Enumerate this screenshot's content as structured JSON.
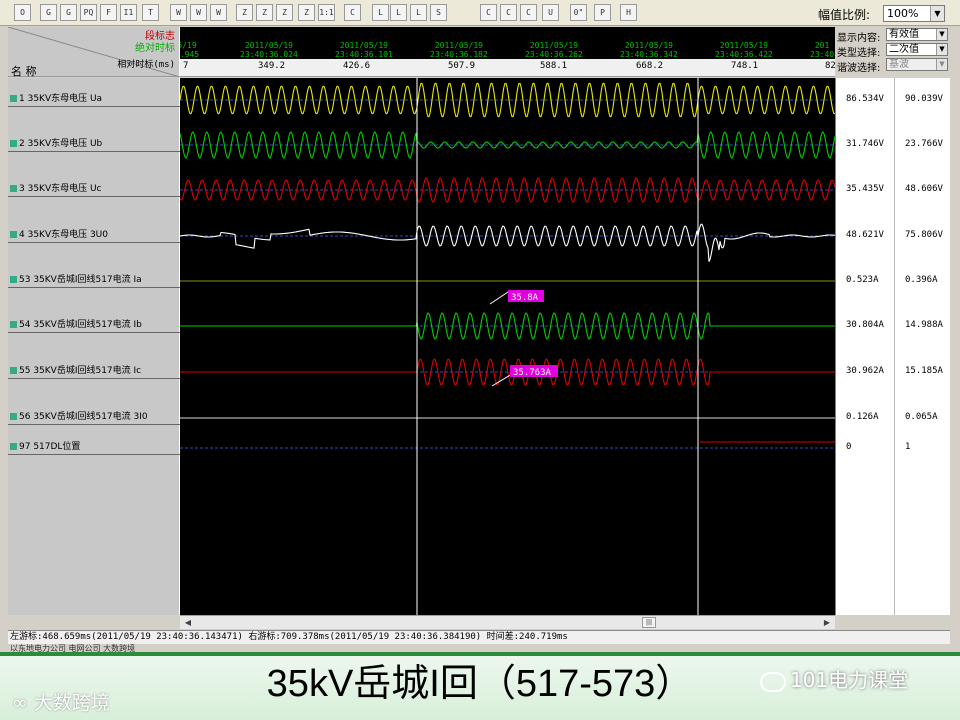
{
  "toolbar": {
    "buttons": [
      "open",
      "grid",
      "grid2",
      "PQ",
      "F",
      "I1",
      "table",
      "wave-a",
      "wave-b",
      "wave-c",
      "zoom-v-in",
      "zoom-v-out",
      "zoom-h-in",
      "zoom-h-out",
      "1:1",
      "check",
      "list-a",
      "list-b",
      "list-c",
      "settings",
      "cursor-a",
      "cursor-b",
      "cursor-c",
      "undo",
      "0\"",
      "print",
      "help"
    ],
    "scale_label": "幅值比例:",
    "scale_value": "100%"
  },
  "header": {
    "mark_label": "段标志",
    "abs_time_label": "绝对时标",
    "rel_time_label": "相对时标(ms)",
    "name_label": "名 称"
  },
  "timeline": {
    "dates": [
      {
        "d": "5/19",
        "t": "0.945"
      },
      {
        "d": "2011/05/19",
        "t": "23:40:36.024"
      },
      {
        "d": "2011/05/19",
        "t": "23:40:36.101"
      },
      {
        "d": "2011/05/19",
        "t": "23:40:36.182"
      },
      {
        "d": "2011/05/19",
        "t": "23:40:36.262"
      },
      {
        "d": "2011/05/19",
        "t": "23:40:36.342"
      },
      {
        "d": "2011/05/19",
        "t": "23:40:36.422"
      },
      {
        "d": "201",
        "t": "23:40"
      }
    ],
    "ms": [
      "7",
      "349.2",
      "426.6",
      "507.9",
      "588.1",
      "668.2",
      "748.1",
      "82"
    ]
  },
  "controls": {
    "display_label": "显示内容:",
    "display_value": "有效值",
    "type_label": "类型选择:",
    "type_value": "二次值",
    "harmonic_label": "谐波选择:",
    "harmonic_value": "基波"
  },
  "channels": [
    {
      "label": "1 35KV东母电压 Ua",
      "v1": "86.534V",
      "v2": "90.039V",
      "color": "#e8e800"
    },
    {
      "label": "2 35KV东母电压 Ub",
      "v1": "31.746V",
      "v2": "23.766V",
      "color": "#00d000"
    },
    {
      "label": "3 35KV东母电压 Uc",
      "v1": "35.435V",
      "v2": "48.606V",
      "color": "#e00000"
    },
    {
      "label": "4 35KV东母电压 3U0",
      "v1": "48.621V",
      "v2": "75.806V",
      "color": "#ffffff"
    },
    {
      "label": "53 35KV岳城Ⅰ回线517电流 Ia",
      "v1": "0.523A",
      "v2": "0.396A",
      "color": "#e8e800"
    },
    {
      "label": "54 35KV岳城Ⅰ回线517电流 Ib",
      "v1": "30.804A",
      "v2": "14.988A",
      "color": "#00d000"
    },
    {
      "label": "55 35KV岳城Ⅰ回线517电流 Ic",
      "v1": "30.962A",
      "v2": "15.185A",
      "color": "#e00000"
    },
    {
      "label": "56 35KV岳城Ⅰ回线517电流 3I0",
      "v1": "0.126A",
      "v2": "0.065A",
      "color": "#ffffff"
    },
    {
      "label": "97 517DL位置",
      "v1": "0",
      "v2": "1",
      "color": "#e00000"
    }
  ],
  "annotations": {
    "ib_peak": "35.8A",
    "ic_peak": "35.763A"
  },
  "status": {
    "cursor_text": "左游标:468.659ms(2011/05/19 23:40:36.143471) 右游标:709.378ms(2011/05/19 23:40:36.384190) 时间差:240.719ms",
    "line2": "以东地电力公司 电网公司 大数跨境"
  },
  "slide": {
    "title": "35kV岳城I回（517-573）",
    "logo_left": "大数跨境",
    "logo_right": "101电力课堂"
  }
}
